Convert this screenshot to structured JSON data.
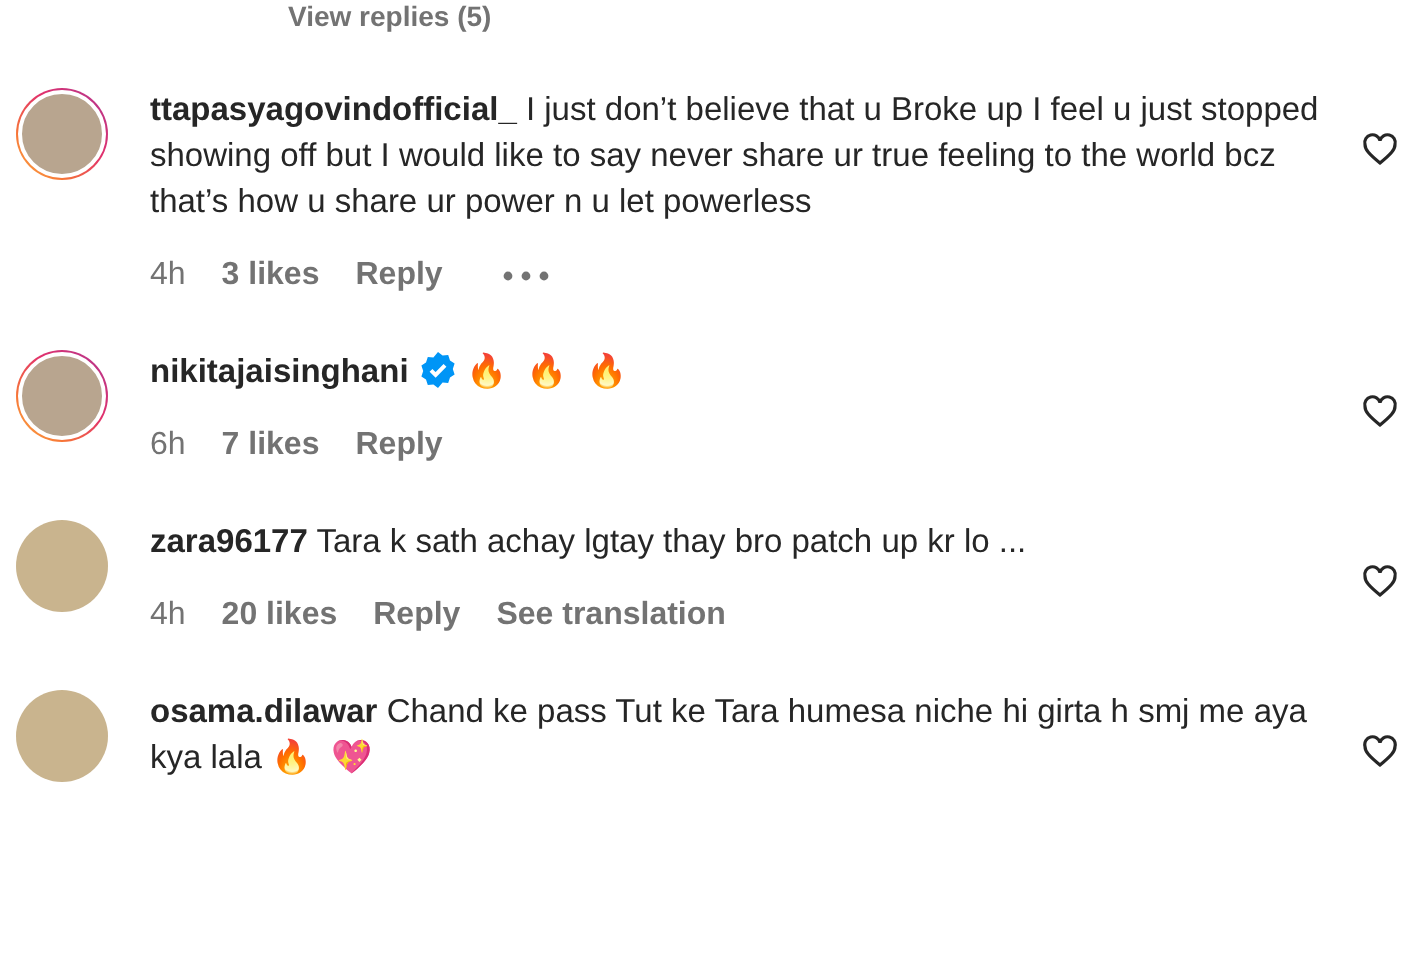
{
  "view_replies": "View replies (5)",
  "comments": [
    {
      "username": "ttapasyagovindofficial_",
      "story_ring": true,
      "verified": false,
      "text": "I just don’t believe that u Broke up I feel u just stopped showing off but I would like to say never share ur true feeling to the world bcz that’s how u share ur power n u let powerless",
      "time": "4h",
      "likes": "3 likes",
      "reply": "Reply",
      "more_options": true
    },
    {
      "username": "nikitajaisinghani",
      "story_ring": true,
      "verified": true,
      "emojis": [
        "🔥",
        "🔥",
        "🔥"
      ],
      "time": "6h",
      "likes": "7 likes",
      "reply": "Reply",
      "more_options": false
    },
    {
      "username": "zara96177",
      "story_ring": false,
      "verified": false,
      "text": "Tara k sath achay lgtay thay bro patch up kr lo ...",
      "time": "4h",
      "likes": "20 likes",
      "reply": "Reply",
      "translation": "See translation",
      "more_options": false
    },
    {
      "username": "osama.dilawar",
      "story_ring": false,
      "verified": false,
      "text": "Chand ke pass Tut ke Tara humesa niche hi girta h smj me aya kya lala",
      "emojis": [
        "🔥",
        "💖"
      ],
      "more_options": false
    }
  ]
}
